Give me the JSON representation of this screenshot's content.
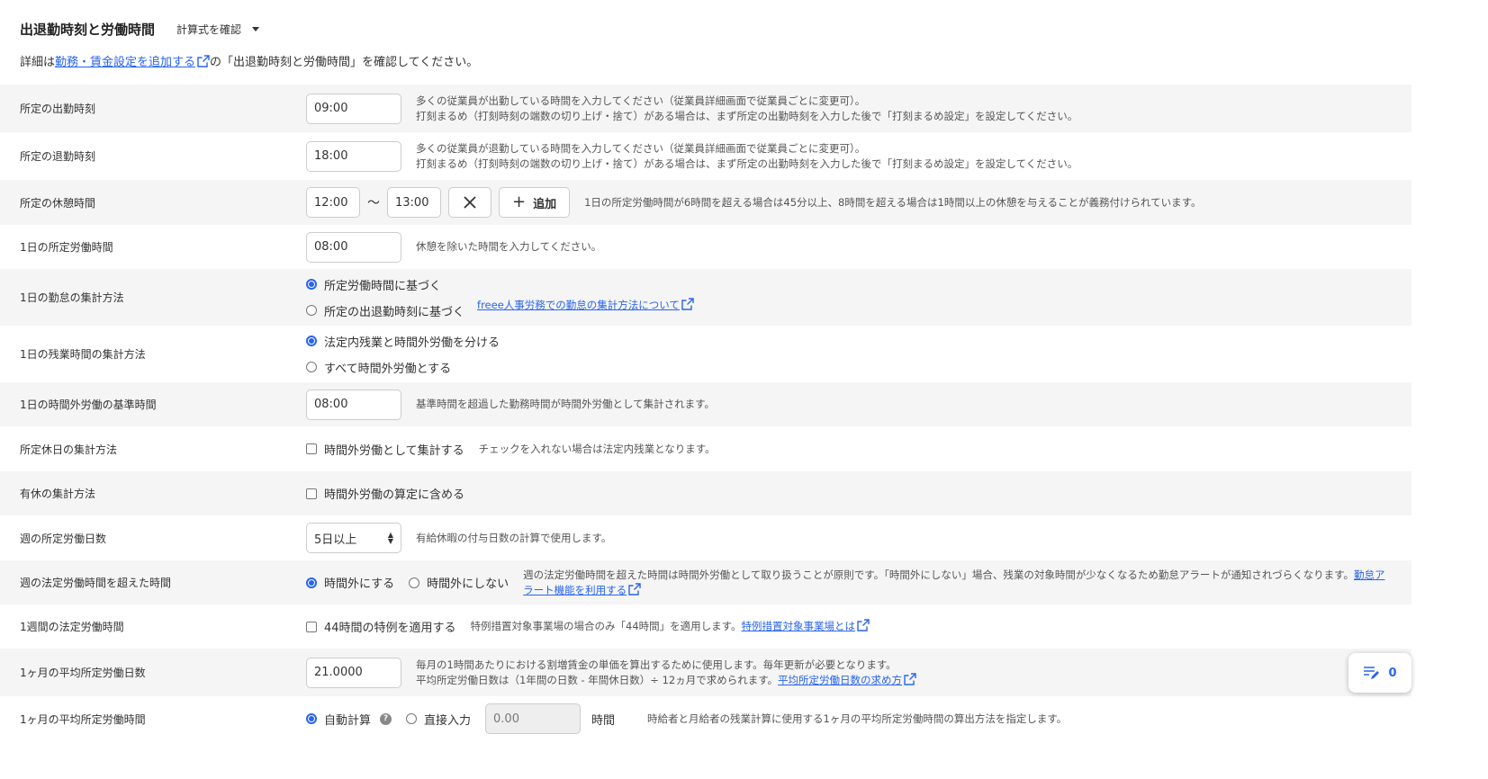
{
  "header": {
    "title": "出退勤時刻と労働時間",
    "calc_button": "計算式を確認"
  },
  "intro": {
    "before": "詳細は",
    "link": "勤務・賃金設定を追加する",
    "after": "の「出退勤時刻と労働時間」を確認してください。"
  },
  "rows": {
    "start_time": {
      "label": "所定の出勤時刻",
      "value": "09:00",
      "desc1": "多くの従業員が出勤している時間を入力してください（従業員詳細画面で従業員ごとに変更可）。",
      "desc2": "打刻まるめ（打刻時刻の端数の切り上げ・捨て）がある場合は、まず所定の出勤時刻を入力した後で「打刻まるめ設定」を設定してください。"
    },
    "end_time": {
      "label": "所定の退勤時刻",
      "value": "18:00",
      "desc1": "多くの従業員が退勤している時間を入力してください（従業員詳細画面で従業員ごとに変更可）。",
      "desc2": "打刻まるめ（打刻時刻の端数の切り上げ・捨て）がある場合は、まず所定の出勤時刻を入力した後で「打刻まるめ設定」を設定してください。"
    },
    "break": {
      "label": "所定の休憩時間",
      "from": "12:00",
      "sep": "〜",
      "to": "13:00",
      "add_label": "追加",
      "desc": "1日の所定労働時間が6時間を超える場合は45分以上、8時間を超える場合は1時間以上の休憩を与えることが義務付けられています。"
    },
    "daily_hours": {
      "label": "1日の所定労働時間",
      "value": "08:00",
      "desc": "休憩を除いた時間を入力してください。"
    },
    "attendance_method": {
      "label": "1日の勤怠の集計方法",
      "option1": "所定労働時間に基づく",
      "option2": "所定の出退勤時刻に基づく",
      "selected": 1,
      "link": "freee人事労務での勤怠の集計方法について"
    },
    "overtime_method": {
      "label": "1日の残業時間の集計方法",
      "option1": "法定内残業と時間外労働を分ける",
      "option2": "すべて時間外労働とする",
      "selected": 1
    },
    "overtime_base": {
      "label": "1日の時間外労働の基準時間",
      "value": "08:00",
      "desc": "基準時間を超過した勤務時間が時間外労働として集計されます。"
    },
    "holiday_method": {
      "label": "所定休日の集計方法",
      "check_label": "時間外労働として集計する",
      "checked": false,
      "desc": "チェックを入れない場合は法定内残業となります。"
    },
    "paid_leave": {
      "label": "有休の集計方法",
      "check_label": "時間外労働の算定に含める",
      "checked": false
    },
    "weekly_days": {
      "label": "週の所定労働日数",
      "value": "5日以上",
      "desc": "有給休暇の付与日数の計算で使用します。"
    },
    "weekly_over": {
      "label": "週の法定労働時間を超えた時間",
      "option1": "時間外にする",
      "option2": "時間外にしない",
      "selected": 1,
      "desc": "週の法定労働時間を超えた時間は時間外労働として取り扱うことが原則です。「時間外にしない」場合、残業の対象時間が少なくなるため勤怠アラートが通知されづらくなります。",
      "link_line1": "勤怠ア",
      "link_line2": "ラート機能を利用する"
    },
    "weekly_legal": {
      "label": "1週間の法定労働時間",
      "check_label": "44時間の特例を適用する",
      "checked": false,
      "desc": "特例措置対象事業場の場合のみ「44時間」を適用します。",
      "link": "特例措置対象事業場とは"
    },
    "monthly_days": {
      "label": "1ヶ月の平均所定労働日数",
      "value": "21.0000",
      "desc1": "毎月の1時間あたりにおける割増賃金の単価を算出するために使用します。毎年更新が必要となります。",
      "desc2": "平均所定労働日数は（1年間の日数 - 年間休日数）÷ 12ヵ月で求められます。",
      "link": "平均所定労働日数の求め方"
    },
    "monthly_hours": {
      "label": "1ヶ月の平均所定労働時間",
      "option1": "自動計算",
      "option2": "直接入力",
      "selected": 1,
      "value": "0.00",
      "unit": "時間",
      "desc": "時給者と月給者の残業計算に使用する1ヶ月の平均所定労働時間の算出方法を指定します。"
    }
  },
  "fab": {
    "count": "0"
  },
  "colors": {
    "accent": "#2864f0",
    "row_alt": "#f5f5f5"
  },
  "icons": [
    "external-link-icon",
    "close-icon",
    "plus-icon",
    "help-icon",
    "memo-edit-icon",
    "caret-down-icon"
  ]
}
